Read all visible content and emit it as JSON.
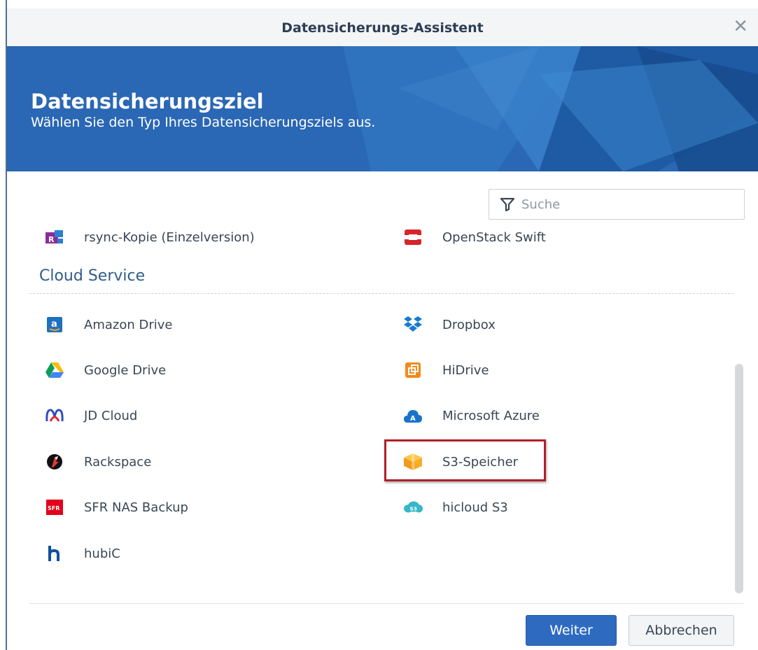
{
  "window": {
    "title": "Datensicherungs-Assistent",
    "close_icon": "close-icon"
  },
  "banner": {
    "title": "Datensicherungsziel",
    "subtitle": "Wählen Sie den Typ Ihres Datensicherungsziels aus."
  },
  "search": {
    "placeholder": "Suche",
    "value": "",
    "icon": "filter-icon"
  },
  "top_items": [
    {
      "label": "rsync-Kopie (Einzelversion)",
      "icon": "rsync-icon"
    },
    {
      "label": "OpenStack Swift",
      "icon": "openstack-icon"
    }
  ],
  "cloud_section": {
    "title": "Cloud Service",
    "items": [
      {
        "label": "Amazon Drive",
        "icon": "amazon-drive-icon"
      },
      {
        "label": "Dropbox",
        "icon": "dropbox-icon"
      },
      {
        "label": "Google Drive",
        "icon": "google-drive-icon"
      },
      {
        "label": "HiDrive",
        "icon": "hidrive-icon"
      },
      {
        "label": "JD Cloud",
        "icon": "jd-cloud-icon"
      },
      {
        "label": "Microsoft Azure",
        "icon": "azure-icon"
      },
      {
        "label": "Rackspace",
        "icon": "rackspace-icon"
      },
      {
        "label": "S3-Speicher",
        "icon": "s3-icon",
        "highlighted": true
      },
      {
        "label": "SFR NAS Backup",
        "icon": "sfr-icon"
      },
      {
        "label": "hicloud S3",
        "icon": "hicloud-icon"
      },
      {
        "label": "hubiC",
        "icon": "hubic-icon"
      }
    ]
  },
  "buttons": {
    "next": "Weiter",
    "cancel": "Abbrechen"
  },
  "colors": {
    "accent": "#2e6bc0",
    "banner": "#2a67b4",
    "highlight": "#b1202a"
  }
}
